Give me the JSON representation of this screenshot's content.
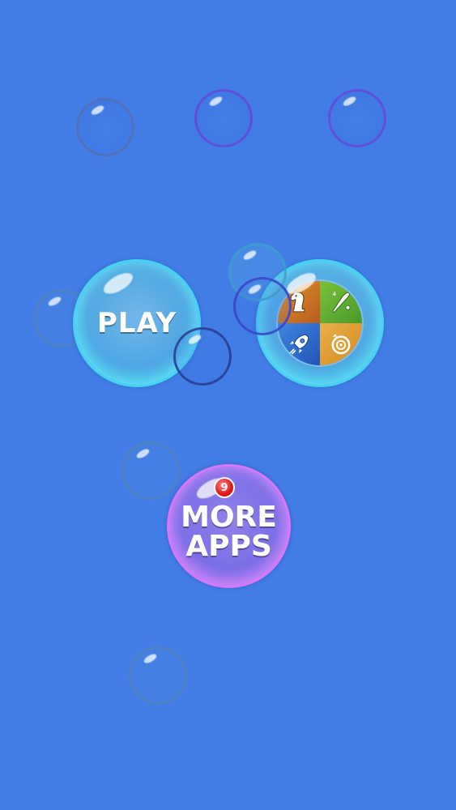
{
  "menu": {
    "play_label": "PLAY",
    "more_apps_line1": "MORE",
    "more_apps_line2": "APPS",
    "more_apps_badge": "9"
  },
  "games_icons": [
    "chess-knight-icon",
    "baseball-bat-icon",
    "rocket-icon",
    "target-timer-icon"
  ],
  "colors": {
    "background": "#417de5",
    "play_bubble": "#46d2f0",
    "more_apps_bubble": "#d778fa",
    "badge": "#e51b1b"
  }
}
